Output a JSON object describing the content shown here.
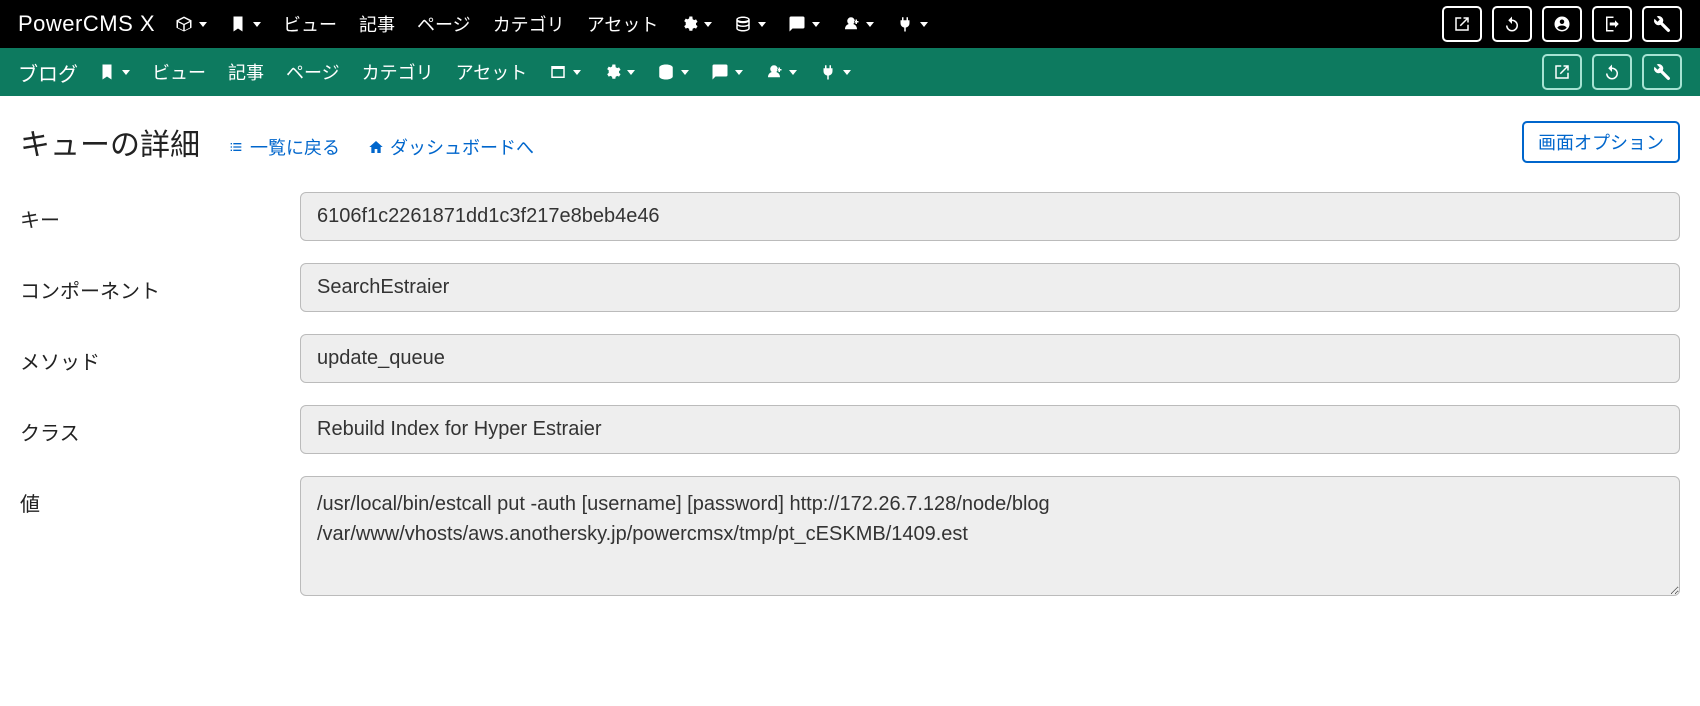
{
  "brand": "PowerCMS X",
  "topnav": {
    "view": "ビュー",
    "entry": "記事",
    "page": "ページ",
    "category": "カテゴリ",
    "asset": "アセット"
  },
  "scope": {
    "name": "ブログ",
    "view": "ビュー",
    "entry": "記事",
    "page": "ページ",
    "category": "カテゴリ",
    "asset": "アセット"
  },
  "header": {
    "title": "キューの詳細",
    "back_to_list": "一覧に戻る",
    "to_dashboard": "ダッシュボードへ",
    "screen_options": "画面オプション"
  },
  "labels": {
    "key": "キー",
    "component": "コンポーネント",
    "method": "メソッド",
    "class": "クラス",
    "value": "値"
  },
  "fields": {
    "key": "6106f1c2261871dd1c3f217e8beb4e46",
    "component": "SearchEstraier",
    "method": "update_queue",
    "class": "Rebuild Index for Hyper Estraier",
    "value": "/usr/local/bin/estcall put -auth [username] [password] http://172.26.7.128/node/blog /var/www/vhosts/aws.anothersky.jp/powercmsx/tmp/pt_cESKMB/1409.est"
  }
}
